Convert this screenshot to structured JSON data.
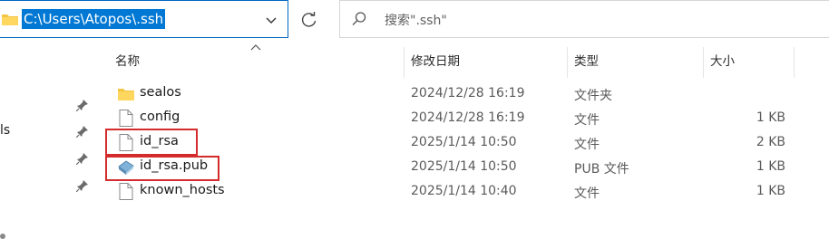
{
  "address_bar": {
    "path": "C:\\Users\\Atopos\\.ssh"
  },
  "search": {
    "placeholder": "搜索\".ssh\""
  },
  "nav": {
    "partial_label": "ls"
  },
  "columns": {
    "name": "名称",
    "modified": "修改日期",
    "type": "类型",
    "size": "大小"
  },
  "files": [
    {
      "name": "sealos",
      "modified": "2024/12/28 16:19",
      "type": "文件夹",
      "size": "",
      "icon": "folder-icon",
      "highlighted": false
    },
    {
      "name": "config",
      "modified": "2024/12/28 16:19",
      "type": "文件",
      "size": "1 KB",
      "icon": "file-icon",
      "highlighted": false
    },
    {
      "name": "id_rsa",
      "modified": "2025/1/14 10:50",
      "type": "文件",
      "size": "2 KB",
      "icon": "file-icon",
      "highlighted": true
    },
    {
      "name": "id_rsa.pub",
      "modified": "2025/1/14 10:50",
      "type": "PUB 文件",
      "size": "1 KB",
      "icon": "pub-file-icon",
      "highlighted": true
    },
    {
      "name": "known_hosts",
      "modified": "2025/1/14 10:40",
      "type": "文件",
      "size": "1 KB",
      "icon": "file-icon",
      "highlighted": false
    }
  ],
  "colors": {
    "accent": "#0078d4",
    "highlight_box": "#d42c2c",
    "folder": "#f4c542"
  }
}
